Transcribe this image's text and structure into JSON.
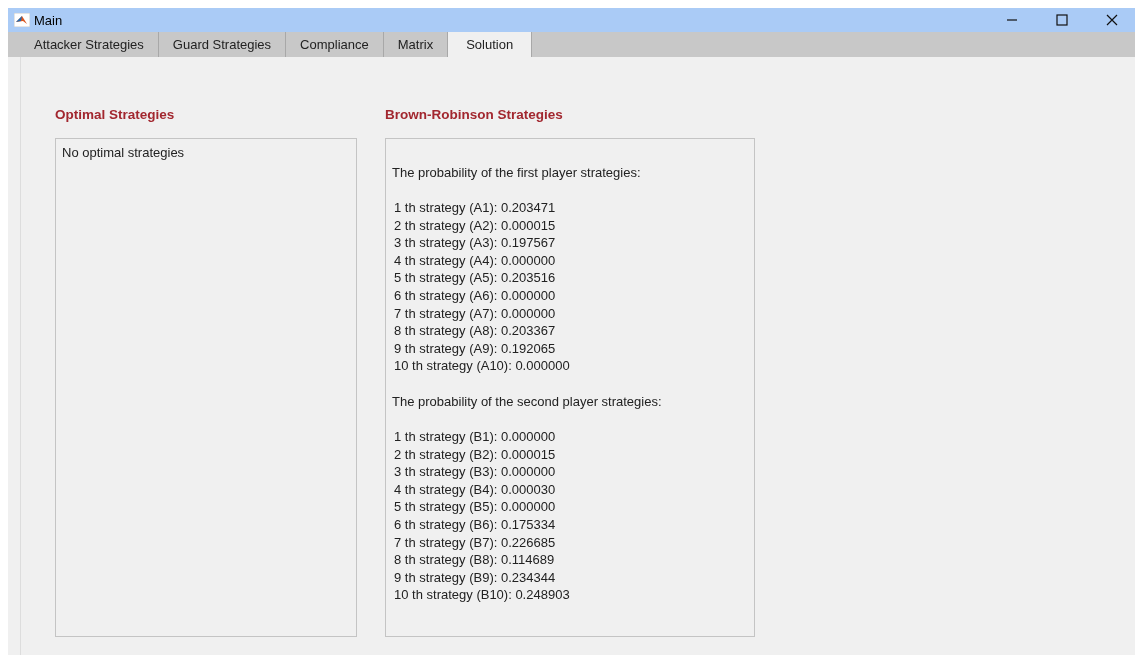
{
  "window": {
    "title": "Main"
  },
  "tabs": [
    {
      "label": "Attacker Strategies",
      "selected": false
    },
    {
      "label": "Guard Strategies",
      "selected": false
    },
    {
      "label": "Compliance",
      "selected": false
    },
    {
      "label": "Matrix",
      "selected": false
    },
    {
      "label": "Solution",
      "selected": true
    }
  ],
  "optimal": {
    "heading": "Optimal Strategies",
    "text": "No optimal strategies"
  },
  "brown_robinson": {
    "heading": "Brown-Robinson Strategies",
    "sections": [
      {
        "title": "The probability of the first player strategies:",
        "lines": [
          "1 th strategy (A1): 0.203471",
          "2 th strategy (A2): 0.000015",
          "3 th strategy (A3): 0.197567",
          "4 th strategy (A4): 0.000000",
          "5 th strategy (A5): 0.203516",
          "6 th strategy (A6): 0.000000",
          "7 th strategy (A7): 0.000000",
          "8 th strategy (A8): 0.203367",
          "9 th strategy (A9): 0.192065",
          "10 th strategy (A10): 0.000000"
        ]
      },
      {
        "title": "The probability of the second player strategies:",
        "lines": [
          "1 th strategy (B1): 0.000000",
          "2 th strategy (B2): 0.000015",
          "3 th strategy (B3): 0.000000",
          "4 th strategy (B4): 0.000030",
          "5 th strategy (B5): 0.000000",
          "6 th strategy (B6): 0.175334",
          "7 th strategy (B7): 0.226685",
          "8 th strategy (B8): 0.114689",
          "9 th strategy (B9): 0.234344",
          "10 th strategy (B10): 0.248903"
        ]
      }
    ]
  }
}
